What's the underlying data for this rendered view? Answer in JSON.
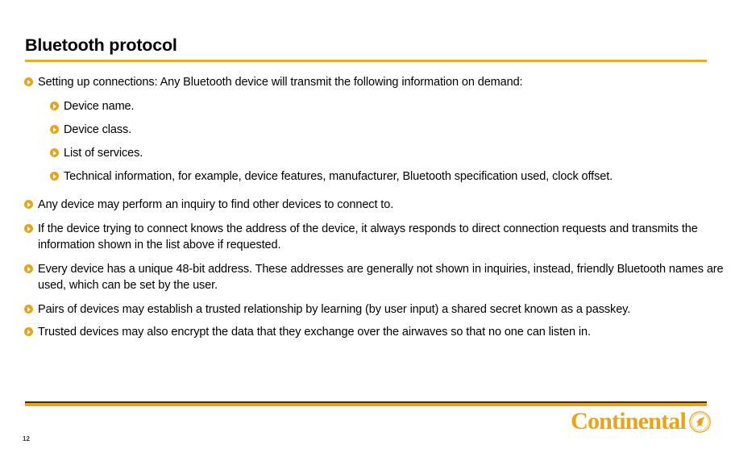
{
  "slide": {
    "title": "Bluetooth protocol",
    "page_number": "12",
    "accent_color": "#e8a317",
    "rule_color": "#e8ab2e",
    "footer_rule_dark_color": "#3d2b12",
    "bullet_icon": "orange-circle-play-bullet-icon"
  },
  "content": {
    "bullets": [
      {
        "level": 1,
        "text": "Setting up connections:  Any Bluetooth device will transmit the following information on demand:"
      },
      {
        "level": 2,
        "text": "Device name."
      },
      {
        "level": 2,
        "text": "Device class."
      },
      {
        "level": 2,
        "text": "List of services."
      },
      {
        "level": 2,
        "text": "Technical information, for example, device features, manufacturer, Bluetooth specification used, clock offset."
      },
      {
        "level": 1,
        "text": "Any device may perform an inquiry to find other devices to connect to."
      },
      {
        "level": 1,
        "text": "If the device trying to connect knows the address of the device, it always responds to direct connection requests and transmits the information shown in the list above if requested."
      },
      {
        "level": 1,
        "text": "Every device has a unique 48-bit address. These addresses are generally not shown in inquiries, instead, friendly Bluetooth names are used, which can be set by the user."
      },
      {
        "level": 1,
        "text": "Pairs of devices may establish a trusted relationship by learning (by user input) a shared secret known as a passkey."
      },
      {
        "level": 1,
        "text": "Trusted devices may also encrypt the data that they exchange over the airwaves so that no one can listen in."
      }
    ]
  },
  "logo": {
    "wordmark": "Continental",
    "emblem": "rearing-horse-emblem-icon"
  }
}
